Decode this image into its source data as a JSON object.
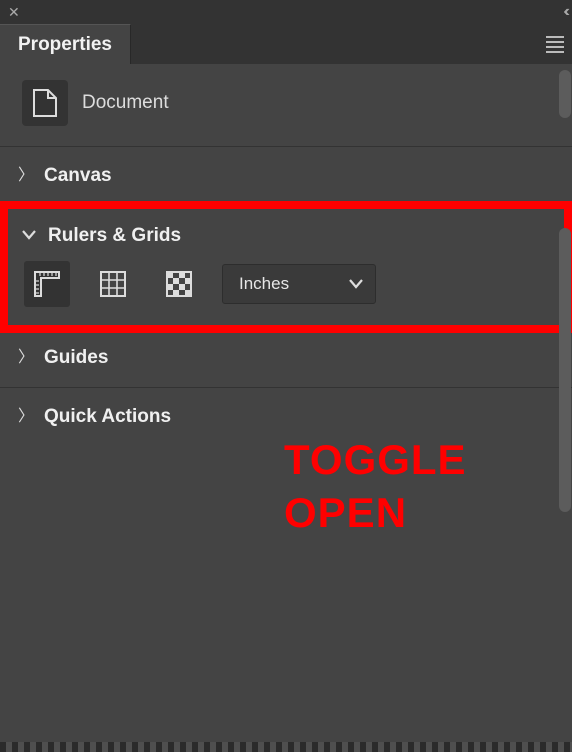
{
  "panel": {
    "tab_label": "Properties"
  },
  "document": {
    "label": "Document"
  },
  "sections": {
    "canvas": {
      "title": "Canvas",
      "expanded": false
    },
    "rulers_grids": {
      "title": "Rulers & Grids",
      "expanded": true,
      "units_selected": "Inches"
    },
    "guides": {
      "title": "Guides",
      "expanded": false
    },
    "quick_actions": {
      "title": "Quick Actions",
      "expanded": false
    }
  },
  "icons": {
    "ruler": "ruler-icon",
    "grid": "grid-icon",
    "transparency": "transparency-grid-icon"
  },
  "annotation": {
    "line1": "TOGGLE",
    "line2": "OPEN"
  }
}
